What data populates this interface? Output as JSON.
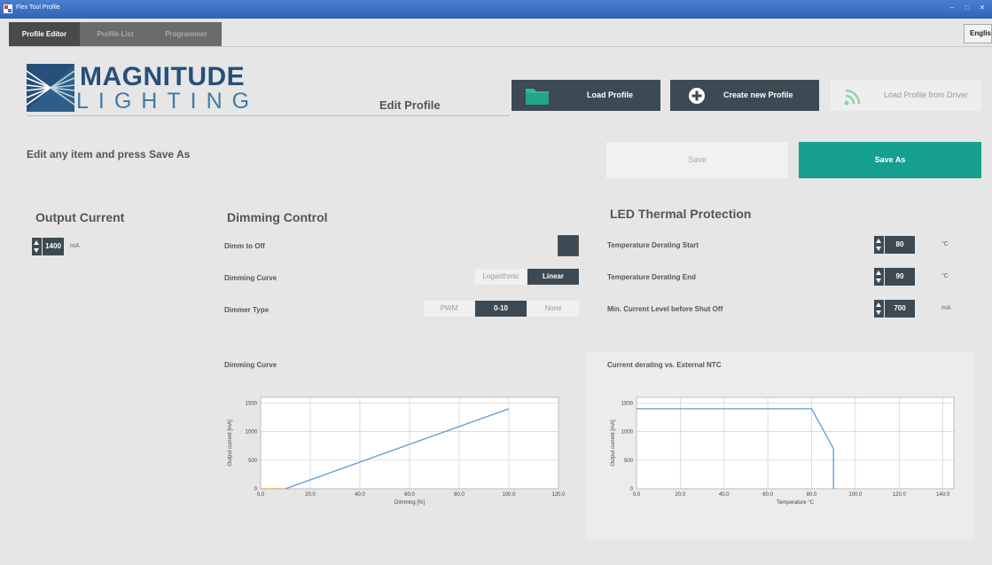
{
  "window": {
    "title": "Flex Tool Profile",
    "controls": [
      "–",
      "□",
      "✕"
    ]
  },
  "tabs": [
    {
      "label": "Profile Editor",
      "active": true
    },
    {
      "label": "Profile List",
      "active": false
    },
    {
      "label": "Programmer",
      "active": false
    }
  ],
  "language": "English",
  "logo": {
    "line1": "MAGNITUDE",
    "line2": "LIGHTING"
  },
  "header": {
    "edit_profile": "Edit Profile",
    "load_profile": "Load Profile",
    "create_new_profile": "Create new Profile",
    "load_from_driver": "Load Profile from Driver"
  },
  "instruction": "Edit any item and press Save As",
  "actions": {
    "save": "Save",
    "save_as": "Save As"
  },
  "output_current": {
    "title": "Output Current",
    "value": "1400",
    "unit": "mA"
  },
  "dimming_control": {
    "title": "Dimming Control",
    "dimm_to_off_label": "Dimm to Off",
    "dimming_curve_label": "Dimming Curve",
    "dimming_curve_options": [
      "Logarithmic",
      "Linear"
    ],
    "dimming_curve_selected": "Linear",
    "dimmer_type_label": "Dimmer Type",
    "dimmer_type_options": [
      "PWM",
      "0-10",
      "None"
    ],
    "dimmer_type_selected": "0-10"
  },
  "thermal": {
    "title": "LED Thermal Protection",
    "rows": [
      {
        "label": "Temperature Derating Start",
        "value": "80",
        "unit": "°C"
      },
      {
        "label": "Temperature Derating End",
        "value": "90",
        "unit": "°C"
      },
      {
        "label": "Min. Current Level before Shut Off",
        "value": "700",
        "unit": "mA"
      }
    ]
  },
  "colors": {
    "accent": "#149f8e",
    "dark": "#3d4a53",
    "brand_dark": "#264f79",
    "brand_light": "#3f7ca7",
    "curve": "#5b9bd5",
    "curve_low": "#e0a95a"
  },
  "chart_data": [
    {
      "type": "line",
      "title": "Dimming Curve",
      "xlabel": "Dimming [%]",
      "ylabel": "Output current [mA]",
      "xlim": [
        0,
        120
      ],
      "ylim": [
        0,
        1600
      ],
      "xticks": [
        "0.0",
        "20.0",
        "40.0",
        "60.0",
        "80.0",
        "100.0",
        "120.0"
      ],
      "yticks": [
        "0",
        "500",
        "1000",
        "1500"
      ],
      "grid": true,
      "series": [
        {
          "x": [
            0,
            10
          ],
          "y": [
            0,
            0
          ]
        },
        {
          "x": [
            10,
            100
          ],
          "y": [
            0,
            1400
          ]
        }
      ]
    },
    {
      "type": "line",
      "title": "Current derating vs. External NTC",
      "xlabel": "Temperature °C",
      "ylabel": "Output current [mA]",
      "xlim": [
        0,
        145
      ],
      "ylim": [
        0,
        1600
      ],
      "xticks": [
        "0.0",
        "20.0",
        "40.0",
        "60.0",
        "80.0",
        "100.0",
        "120.0",
        "140.0"
      ],
      "yticks": [
        "0",
        "500",
        "1000",
        "1500"
      ],
      "grid": true,
      "series": [
        {
          "x": [
            0,
            80,
            90,
            90
          ],
          "y": [
            1400,
            1400,
            700,
            0
          ]
        }
      ]
    }
  ]
}
